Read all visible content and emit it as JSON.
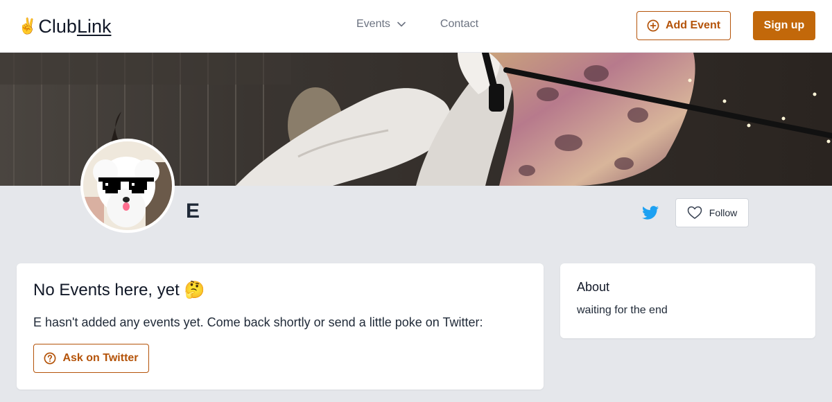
{
  "header": {
    "logo_emoji": "✌️",
    "logo_part1": "Club",
    "logo_part2": "Link",
    "nav_events": "Events",
    "nav_contact": "Contact",
    "add_event_label": "Add Event",
    "signup_label": "Sign up"
  },
  "profile": {
    "name": "E",
    "follow_label": "Follow"
  },
  "events": {
    "title": "No Events here, yet 🤔",
    "message": "E hasn't added any events yet. Come back shortly or send a little poke on Twitter:",
    "ask_label": "Ask on Twitter"
  },
  "about": {
    "title": "About",
    "text": "waiting for the end"
  },
  "colors": {
    "accent": "#c2680a",
    "accent_text": "#b45309",
    "page_bg": "#e5e7eb",
    "twitter": "#1da1f2"
  },
  "icons": [
    "chevron-down-icon",
    "plus-circle-icon",
    "twitter-icon",
    "heart-icon",
    "question-circle-icon"
  ]
}
